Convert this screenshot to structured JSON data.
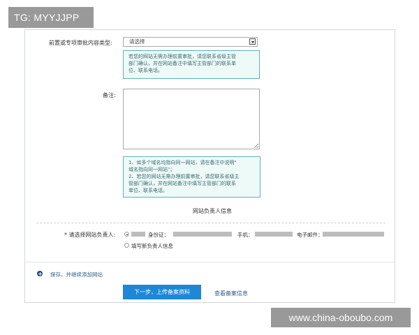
{
  "watermarks": {
    "top_left": "TG: MYYJJPP",
    "bottom_right": "www.china-oboubo.com"
  },
  "form": {
    "approval_type": {
      "label": "前置或专项审批内容类型:",
      "selected": "请选择"
    },
    "approval_tip": "若您的网站无需办理前置审批，请您联系省级主管\n部门确认，并在网站备注中填写主管部门的联系单\n位、联系电话。",
    "remarks": {
      "label": "备注:",
      "value": ""
    },
    "remarks_tip": "1、如多个域名均指向同一网站，请在备注中说明\"\n  域名指向同一网站\"；\n2、若您的网站无需办理前置审批，请您联系省级主\n管部门确认，并在网站备注中填写主管部门的联系\n单位、联系电话。"
  },
  "responsible_section": {
    "title": "网站负责人信息",
    "select_label": "* 请选择网站负责人:",
    "id_label": "身份证：",
    "phone_label": "手机：",
    "email_label": "电子邮件：",
    "new_option_label": "填写新负责人信息"
  },
  "footer": {
    "save_add_link": "保存，并继续添加网站",
    "next_button": "下一步，上传备案资料",
    "view_link": "查看备案信息"
  }
}
